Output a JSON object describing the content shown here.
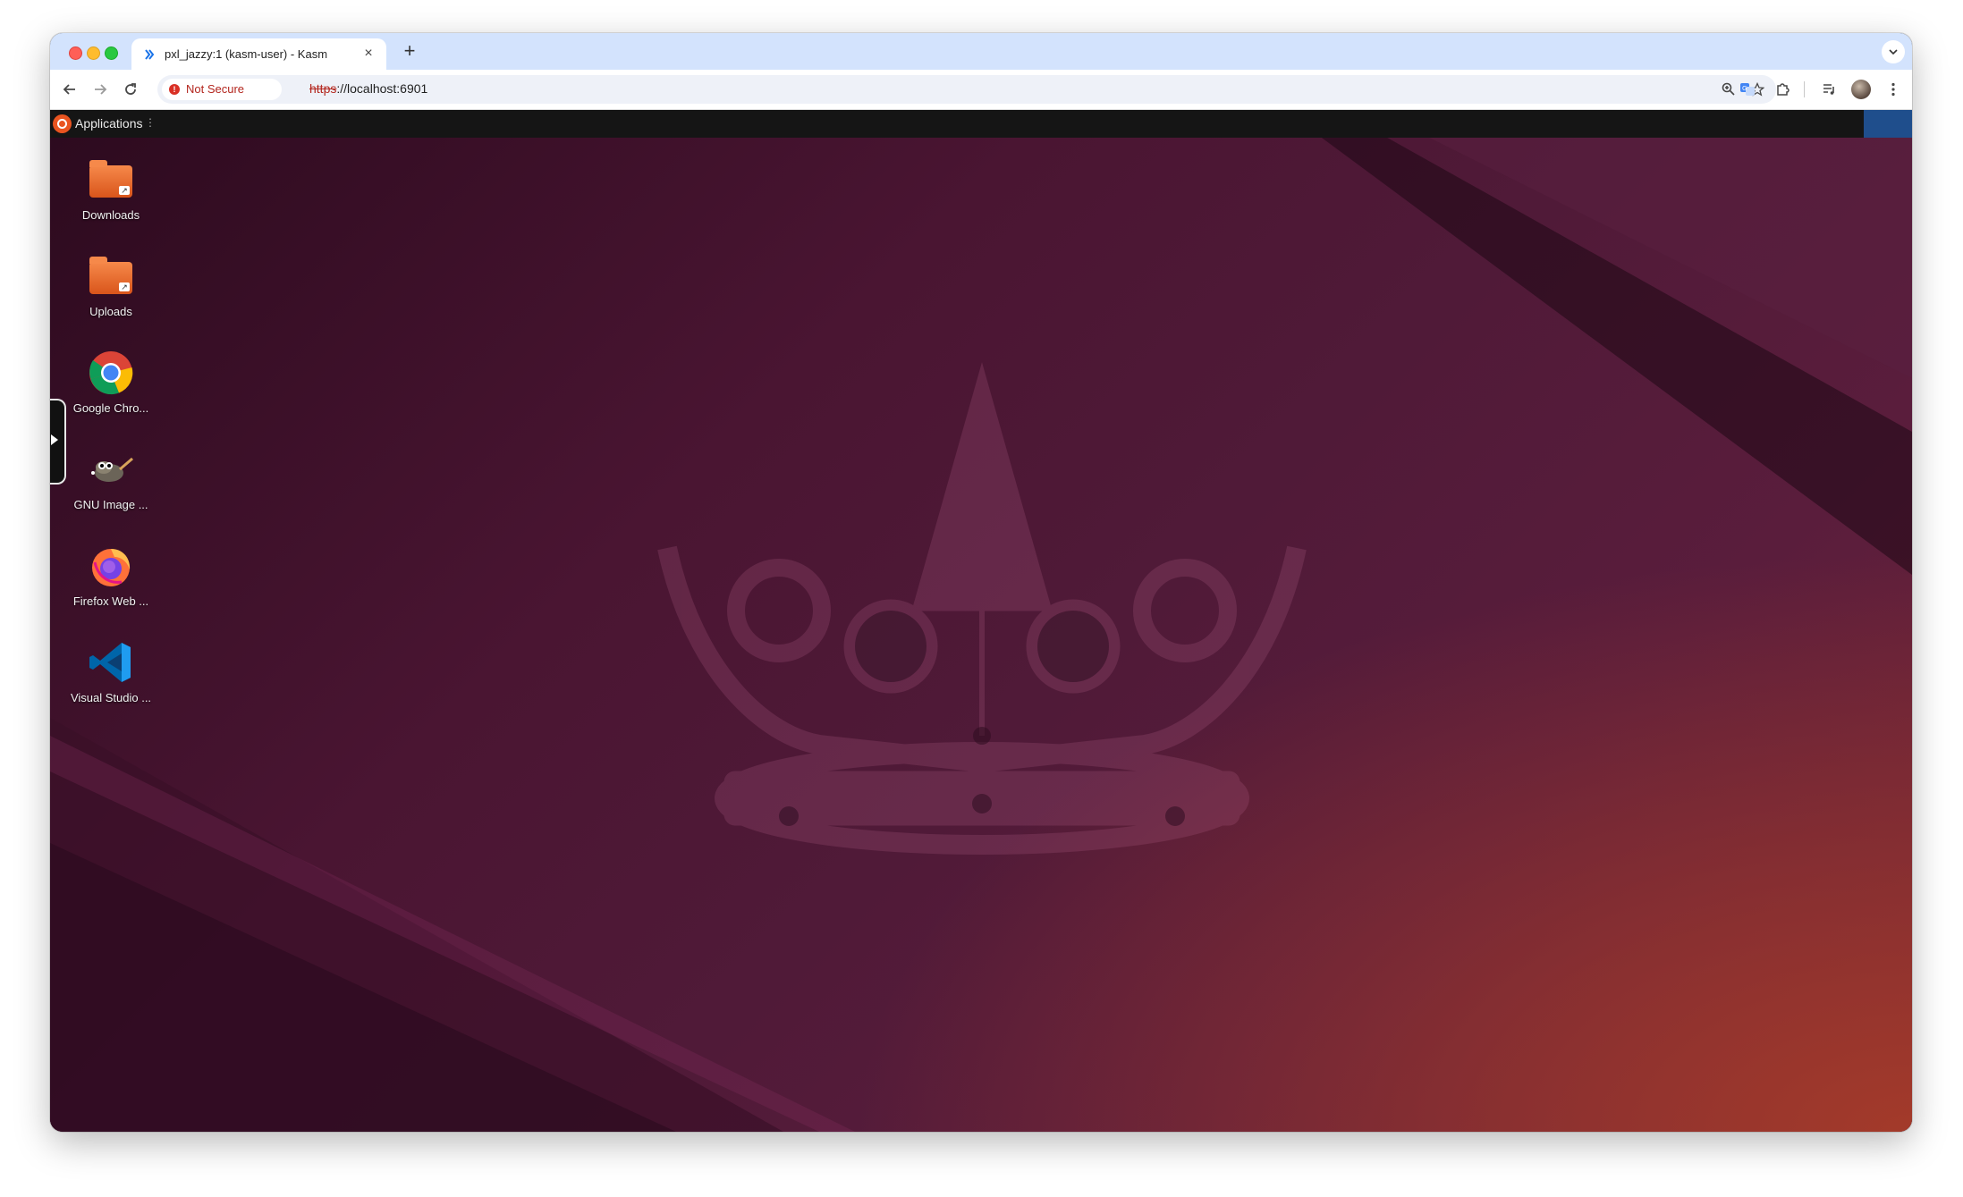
{
  "browser": {
    "tab_title": "pxl_jazzy:1 (kasm-user) - Kasm",
    "security_label": "Not Secure",
    "url_scheme": "https",
    "url_rest": "://localhost:6901",
    "new_tab_symbol": "+",
    "close_symbol": "×"
  },
  "desktop": {
    "panel": {
      "applications_label": "Applications"
    },
    "icons": [
      {
        "label": "Downloads",
        "icon": "folder-icon"
      },
      {
        "label": "Uploads",
        "icon": "folder-icon"
      },
      {
        "label": "Google Chro...",
        "icon": "chrome-icon"
      },
      {
        "label": "GNU Image ...",
        "icon": "gimp-icon"
      },
      {
        "label": "Firefox Web ...",
        "icon": "firefox-icon"
      },
      {
        "label": "Visual Studio ...",
        "icon": "vscode-icon"
      }
    ]
  },
  "colors": {
    "accent_ubuntu": "#e95420",
    "tabstrip_bg": "#d3e3fd",
    "desktop_bg": "#4a1532"
  }
}
